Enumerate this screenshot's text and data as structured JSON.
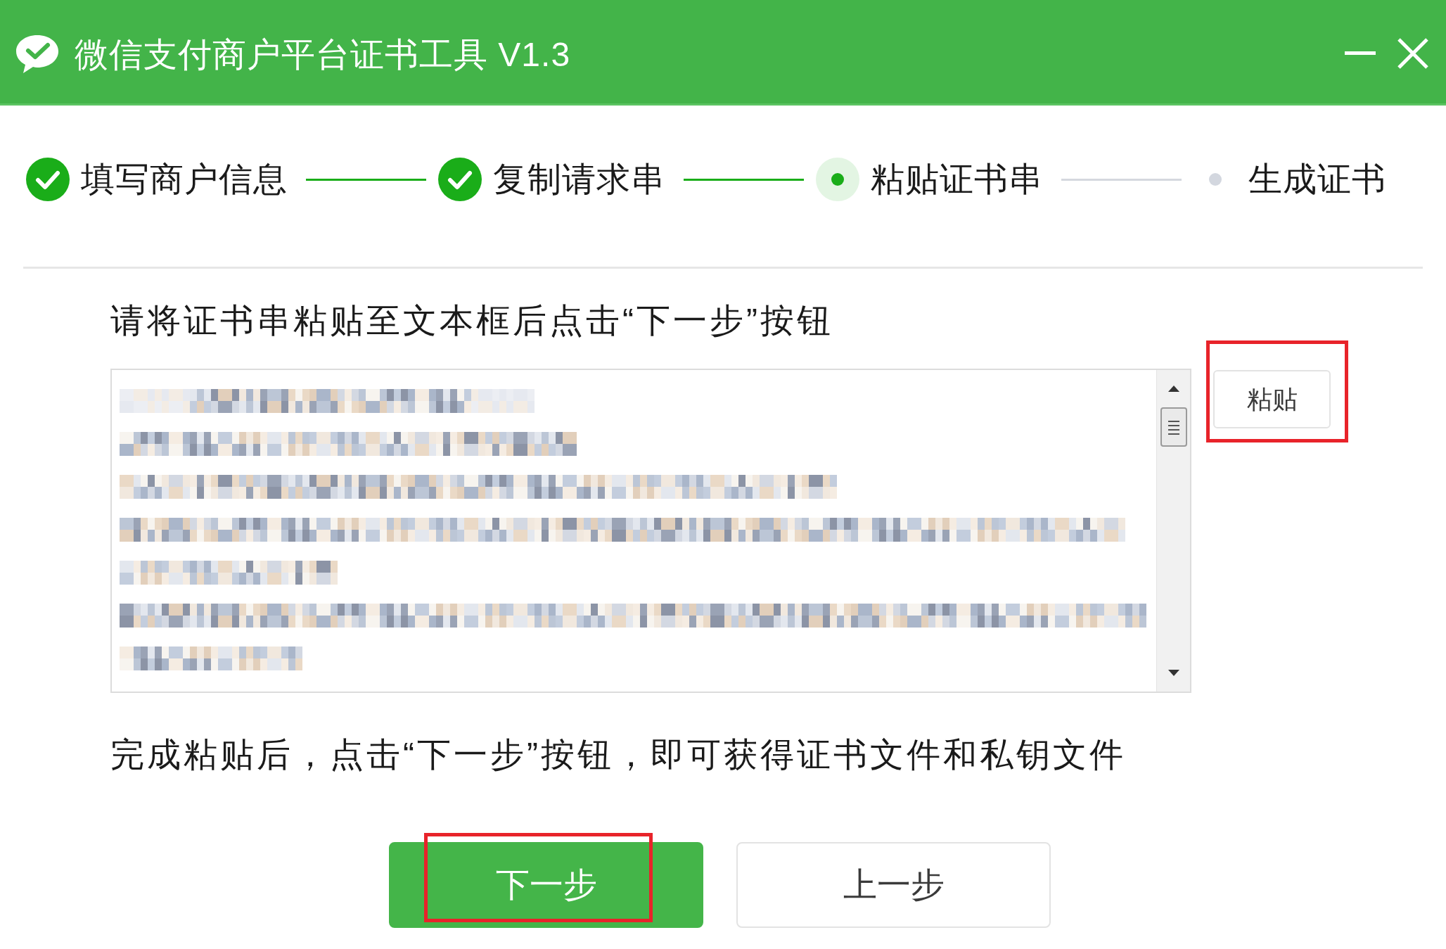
{
  "window": {
    "title": "微信支付商户平台证书工具 V1.3"
  },
  "steps": [
    {
      "label": "填写商户信息",
      "completed": true,
      "current": false
    },
    {
      "label": "复制请求串",
      "completed": true,
      "current": false
    },
    {
      "label": "粘贴证书串",
      "completed": false,
      "current": true
    },
    {
      "label": "生成证书",
      "completed": false,
      "current": false
    }
  ],
  "instruction": "请将证书串粘贴至文本框后点击“下一步”按钮",
  "paste_button": {
    "label": "粘贴",
    "highlighted": true
  },
  "hint": "完成粘贴后，点击“下一步”按钮，即可获得证书文件和私钥文件",
  "buttons": [
    {
      "label": "下一步",
      "kind": "primary",
      "highlighted": true
    },
    {
      "label": "上一步",
      "kind": "secondary",
      "highlighted": false
    }
  ]
}
